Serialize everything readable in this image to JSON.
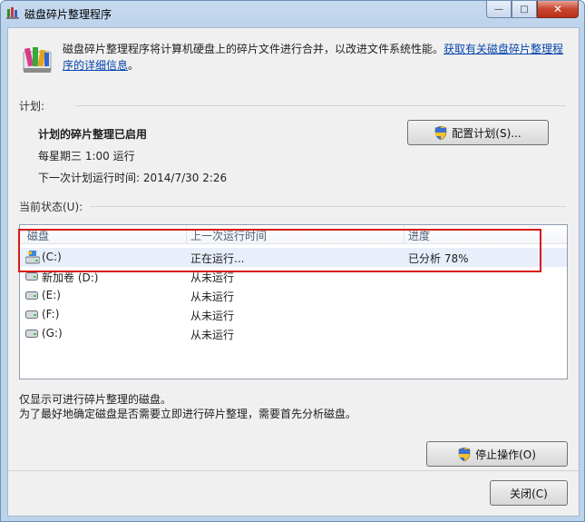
{
  "window": {
    "title": "磁盘碎片整理程序",
    "minimize_label": "—",
    "maximize_label": "□",
    "close_label": "✕"
  },
  "intro": {
    "text": "磁盘碎片整理程序将计算机硬盘上的碎片文件进行合并，以改进文件系统性能。",
    "link": "获取有关磁盘碎片整理程序的详细信息",
    "link_suffix": "。"
  },
  "schedule": {
    "group_label": "计划:",
    "status": "计划的碎片整理已启用",
    "frequency": "每星期三  1:00 运行",
    "next_run": "下一次计划运行时间: 2014/7/30 2:26",
    "configure_button": "配置计划(S)..."
  },
  "current_status": {
    "group_label": "当前状态(U):",
    "columns": [
      "磁盘",
      "上一次运行时间",
      "进度"
    ],
    "rows": [
      {
        "disk": "(C:)",
        "last_run": "正在运行...",
        "progress": "已分析 78%"
      },
      {
        "disk": "新加卷 (D:)",
        "last_run": "从未运行",
        "progress": ""
      },
      {
        "disk": "(E:)",
        "last_run": "从未运行",
        "progress": ""
      },
      {
        "disk": "(F:)",
        "last_run": "从未运行",
        "progress": ""
      },
      {
        "disk": "(G:)",
        "last_run": "从未运行",
        "progress": ""
      }
    ]
  },
  "notes": {
    "line1": "仅显示可进行碎片整理的磁盘。",
    "line2": "为了最好地确定磁盘是否需要立即进行碎片整理，需要首先分析磁盘。"
  },
  "buttons": {
    "stop": "停止操作(O)",
    "close": "关闭(C)"
  },
  "colors": {
    "highlight": "#d81818",
    "link": "#0645ad",
    "window_frame": "#bcd3ec"
  }
}
